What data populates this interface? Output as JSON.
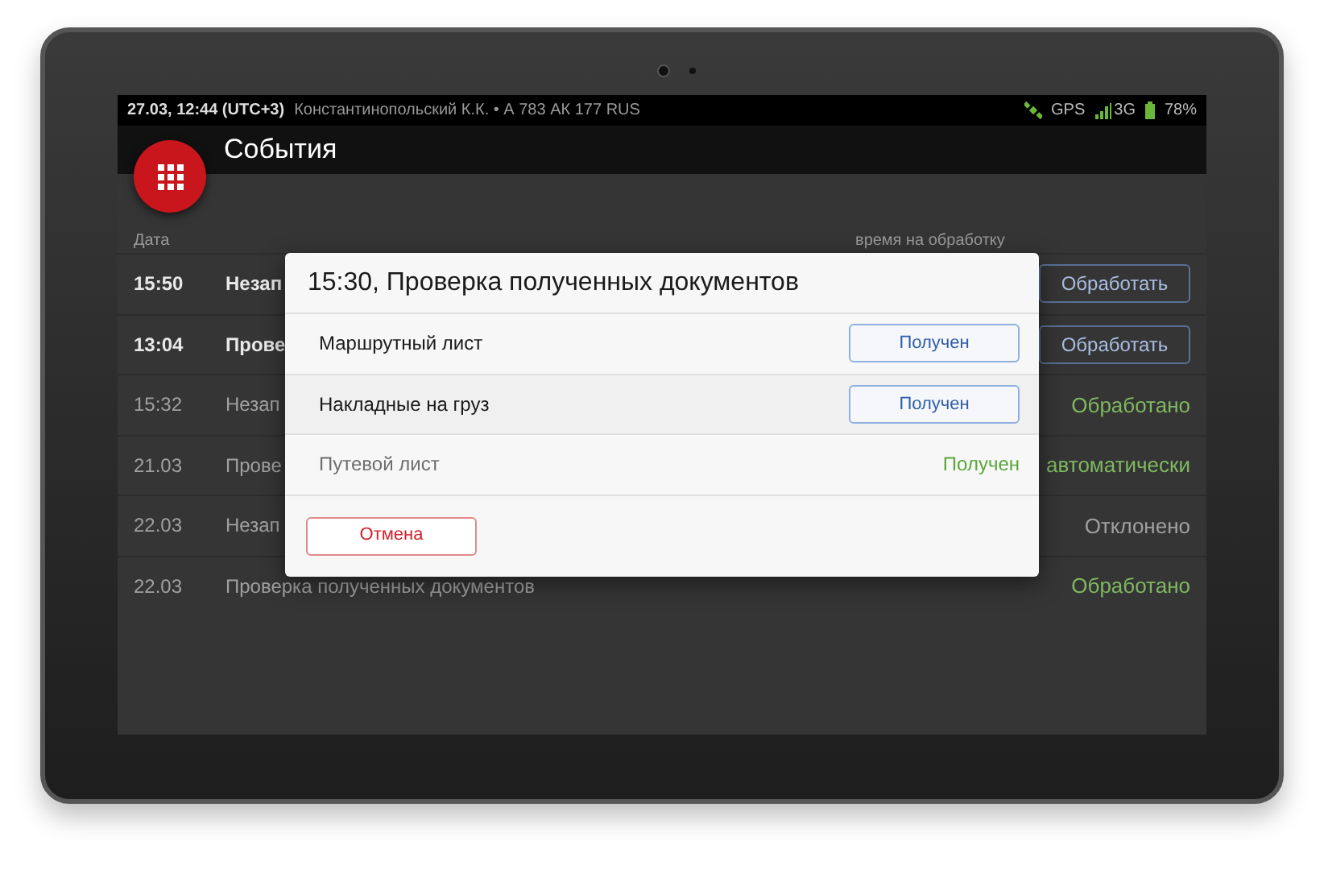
{
  "status_bar": {
    "datetime": "27.03, 12:44 (UTC+3)",
    "driver": "Константинопольский К.К. • А 783 АК 177 RUS",
    "gps": "GPS",
    "network": "3G",
    "battery": "78%"
  },
  "app_bar": {
    "title": "События"
  },
  "table": {
    "columns": [
      "Дата",
      "время на обработку"
    ],
    "rows": [
      {
        "date": "15:50",
        "title": "Незап",
        "unread": true,
        "action": {
          "kind": "button",
          "label": "Обработать"
        }
      },
      {
        "date": "13:04",
        "title": "Прове",
        "unread": true,
        "action": {
          "kind": "button",
          "label": "Обработать"
        }
      },
      {
        "date": "15:32",
        "title": "Незап",
        "unread": false,
        "action": {
          "kind": "done",
          "label": "Обработано"
        }
      },
      {
        "date": "21.03",
        "title": "Прове",
        "unread": false,
        "action": {
          "kind": "done",
          "label": "автоматически"
        }
      },
      {
        "date": "22.03",
        "title": "Незап",
        "unread": false,
        "action": {
          "kind": "rejected",
          "label": "Отклонено"
        }
      },
      {
        "date": "22.03",
        "title": "Проверка полученных документов",
        "unread": false,
        "action": {
          "kind": "done",
          "label": "Обработано"
        }
      }
    ]
  },
  "dialog": {
    "title": "15:30, Проверка полученных документов",
    "items": [
      {
        "name": "Маршрутный лист",
        "disabled": false,
        "kind": "button",
        "status": "Получен"
      },
      {
        "name": "Накладные на груз",
        "disabled": false,
        "kind": "button",
        "status": "Получен"
      },
      {
        "name": "Путевой лист",
        "disabled": true,
        "kind": "done",
        "status": "Получен"
      }
    ],
    "cancel": "Отмена"
  }
}
